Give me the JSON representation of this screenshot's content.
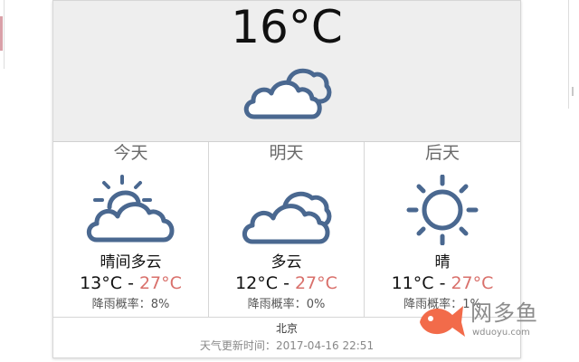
{
  "current": {
    "temperature": "16°C",
    "icon": "cloudy-icon"
  },
  "forecast": [
    {
      "day": "今天",
      "icon": "partly-cloudy-icon",
      "condition": "晴间多云",
      "low": "13°C",
      "separator": " - ",
      "high": "27°C",
      "rain_label": "降雨概率：",
      "rain_value": "8%"
    },
    {
      "day": "明天",
      "icon": "cloudy-icon",
      "condition": "多云",
      "low": "12°C",
      "separator": " - ",
      "high": "27°C",
      "rain_label": "降雨概率：",
      "rain_value": "0%"
    },
    {
      "day": "后天",
      "icon": "sunny-icon",
      "condition": "晴",
      "low": "11°C",
      "separator": " - ",
      "high": "27°C",
      "rain_label": "降雨概率：",
      "rain_value": "1%"
    }
  ],
  "footer": {
    "city": "北京",
    "updated_label": "天气更新时间：",
    "updated_value": "2017-04-16 22:51"
  },
  "watermark": {
    "name": "网多鱼",
    "url": "wduoyu.com"
  },
  "colors": {
    "icon_stroke": "#4a6890",
    "high_temp": "#d9706b",
    "header_bg": "#eeeeee",
    "watermark_fish": "#f26b4a"
  }
}
